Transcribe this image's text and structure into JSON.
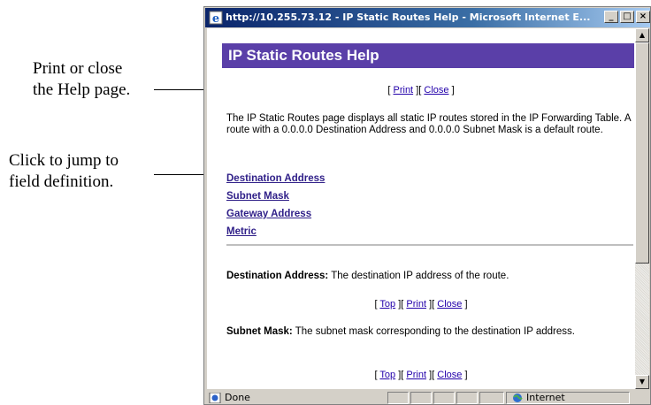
{
  "callouts": {
    "print_close": [
      "Print or close",
      "the Help page."
    ],
    "jump": [
      "Click to jump to",
      "field definition."
    ]
  },
  "window": {
    "title": "http://10.255.73.12 - IP Static Routes Help - Microsoft Internet E...",
    "buttons": {
      "minimize": "_",
      "maximize": "□",
      "close": "×"
    }
  },
  "page": {
    "heading": "IP Static Routes Help",
    "nav_top": {
      "print": "Print",
      "close": "Close"
    },
    "intro": "The IP Static Routes page displays all static IP routes stored in the IP Forwarding Table. A route with a 0.0.0.0 Destination Address and 0.0.0.0 Subnet Mask is a default route.",
    "field_links": [
      "Destination Address",
      "Subnet Mask",
      "Gateway Address",
      "Metric"
    ],
    "definitions": [
      {
        "term": "Destination Address:",
        "text": " The destination IP address of the route."
      },
      {
        "term": "Subnet Mask:",
        "text": " The subnet mask corresponding to the destination IP address."
      }
    ],
    "nav_section": {
      "top": "Top",
      "print": "Print",
      "close": "Close"
    },
    "bracket_open": "[",
    "bracket_close": "]"
  },
  "statusbar": {
    "status": "Done",
    "zone": "Internet"
  },
  "icons": [
    "ie-icon",
    "page-icon",
    "globe-icon"
  ]
}
